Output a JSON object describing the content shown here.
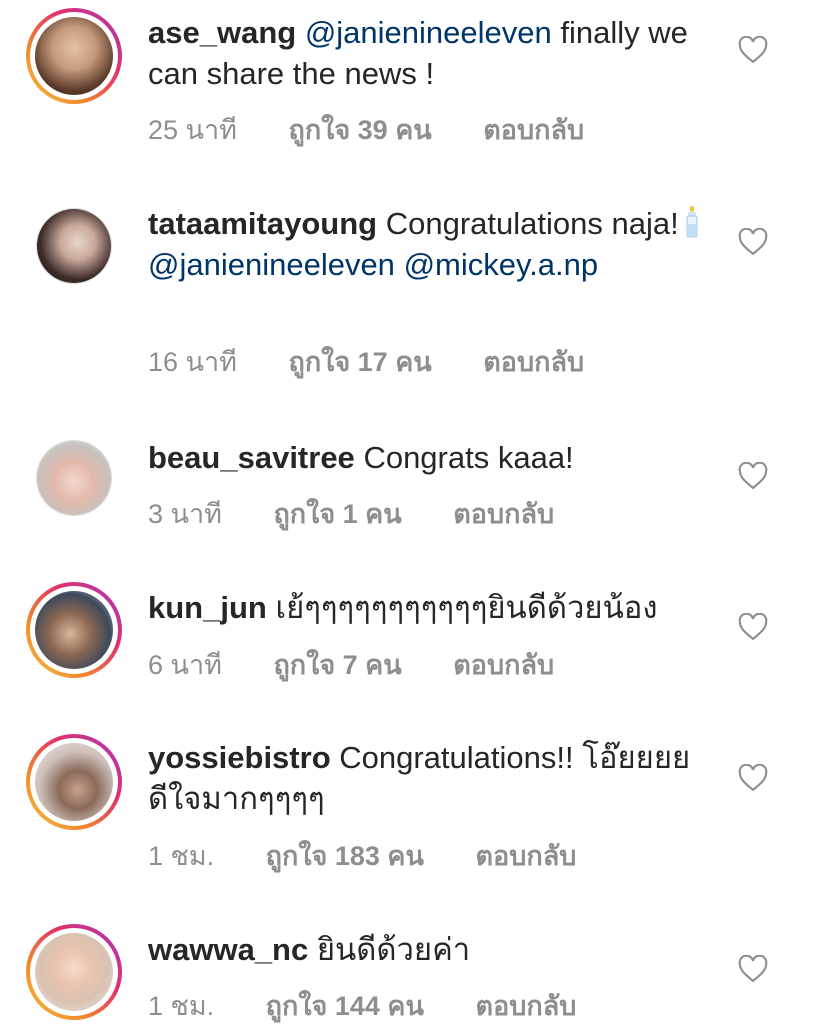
{
  "comments": [
    {
      "username": "ase_wang",
      "mention": "@janienineeleven",
      "text": "finally we can share the news !",
      "time": "25 นาที",
      "likes": "ถูกใจ 39 คน",
      "reply": "ตอบกลับ",
      "story_ring": true
    },
    {
      "username": "tataamitayoung",
      "text_before": "Congratulations naja!",
      "emoji": "baby-bottle-icon",
      "mention1": "@janienineeleven",
      "mention2": "@mickey.a.np",
      "time": "16 นาที",
      "likes": "ถูกใจ 17 คน",
      "reply": "ตอบกลับ",
      "story_ring": false
    },
    {
      "username": "beau_savitree",
      "text": "Congrats kaaa!",
      "time": "3 นาที",
      "likes": "ถูกใจ 1 คน",
      "reply": "ตอบกลับ",
      "story_ring": false
    },
    {
      "username": "kun_jun",
      "text": "เย้ๆๆๆๆๆๆๆๆๆๆๆยินดีด้วยน้อง",
      "time": "6 นาที",
      "likes": "ถูกใจ 7 คน",
      "reply": "ตอบกลับ",
      "story_ring": true
    },
    {
      "username": "yossiebistro",
      "text": "Congratulations!! โอ๊ยยยย ดีใจมากๆๆๆๆ",
      "time": "1 ชม.",
      "likes": "ถูกใจ 183 คน",
      "reply": "ตอบกลับ",
      "story_ring": true
    },
    {
      "username": "wawwa_nc",
      "text": "ยินดีด้วยค่า",
      "time": "1 ชม.",
      "likes": "ถูกใจ 144 คน",
      "reply": "ตอบกลับ",
      "story_ring": true
    }
  ],
  "colors": {
    "text": "#262626",
    "mention": "#003569",
    "meta": "#8e8e8e",
    "heart": "#8e8e8e"
  }
}
